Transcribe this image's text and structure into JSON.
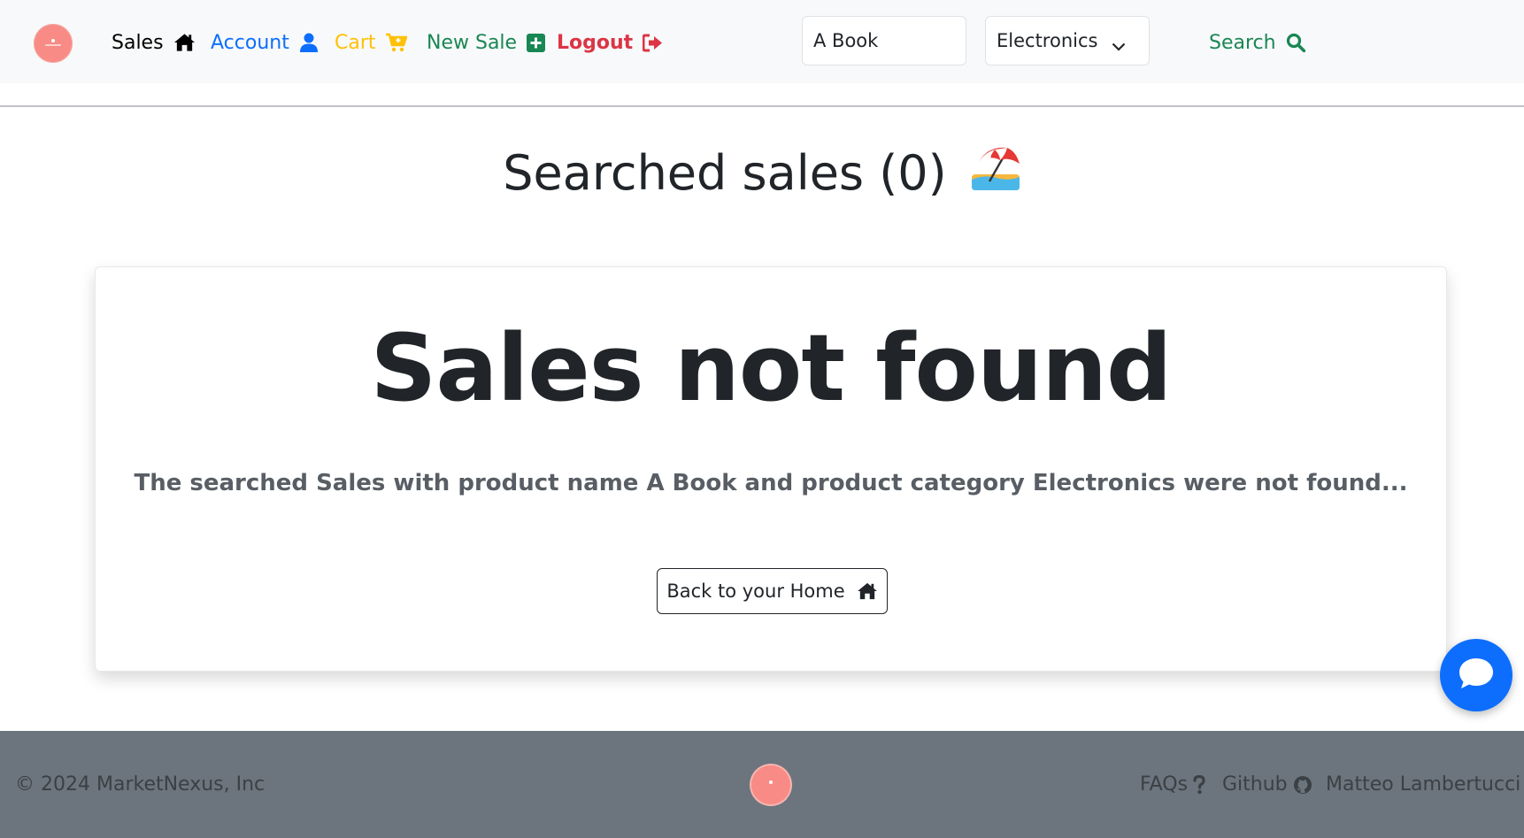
{
  "navbar": {
    "items": [
      {
        "label": "Sales",
        "icon": "home-icon",
        "color": "#000000"
      },
      {
        "label": "Account",
        "icon": "user-icon",
        "color": "#0d6efd"
      },
      {
        "label": "Cart",
        "icon": "cart-plus-icon",
        "color": "#ffc107"
      },
      {
        "label": "New Sale",
        "icon": "square-plus-icon",
        "color": "#198754"
      },
      {
        "label": "Logout",
        "icon": "sign-out-icon",
        "color": "#dc3545"
      }
    ],
    "search": {
      "value": "A Book",
      "category": "Electronics",
      "button_label": "Search",
      "button_icon": "magnifier-icon"
    }
  },
  "main": {
    "title": "Searched sales (0)",
    "title_emoji": "🏖️",
    "card": {
      "heading": "Sales not found",
      "message": "The searched Sales with product name A Book and product category Electronics were not found...",
      "button_label": "Back to your Home",
      "button_icon": "home-icon"
    },
    "chat_icon": "chat-bubble-icon"
  },
  "footer": {
    "copyright": "© 2024 MarketNexus, Inc",
    "links": [
      {
        "label": "FAQs",
        "icon": "question-icon"
      },
      {
        "label": "Github",
        "icon": "github-icon"
      },
      {
        "label": "Matteo Lambertucci",
        "icon": "linkedin-icon"
      }
    ]
  },
  "colors": {
    "primary": "#0d6efd",
    "success": "#198754",
    "warning": "#ffc107",
    "danger": "#dc3545",
    "footer_bg": "#6c757d",
    "brand": "#f88b85"
  }
}
